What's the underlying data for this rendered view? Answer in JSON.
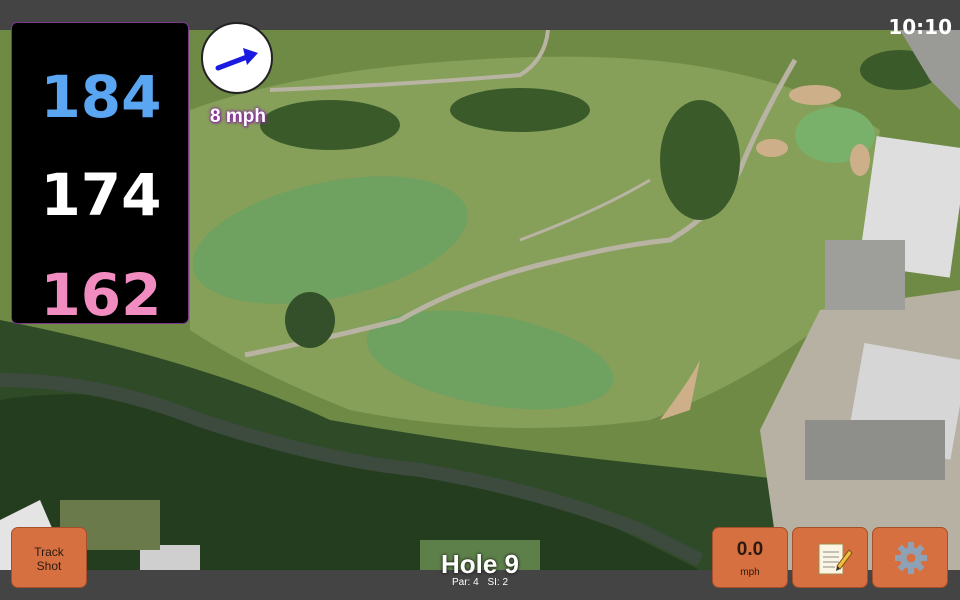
{
  "status": {
    "time": "10:10"
  },
  "distances": {
    "back": "184",
    "middle": "174",
    "front": "162"
  },
  "wind": {
    "speed_label": "8 mph",
    "direction_icon": "arrow-east-icon"
  },
  "buttons": {
    "track_shot": {
      "line1": "Track",
      "line2": "Shot"
    },
    "speed": {
      "value": "0.0",
      "unit": "mph"
    },
    "notes_icon": "notepad-icon",
    "settings_icon": "gear-icon"
  },
  "hole": {
    "title": "Hole 9",
    "par": "Par: 4",
    "si": "SI: 2"
  },
  "colors": {
    "back_distance": "#5aa6f2",
    "middle_distance": "#ffffff",
    "front_distance": "#f08cc0",
    "button": "#d77040"
  }
}
